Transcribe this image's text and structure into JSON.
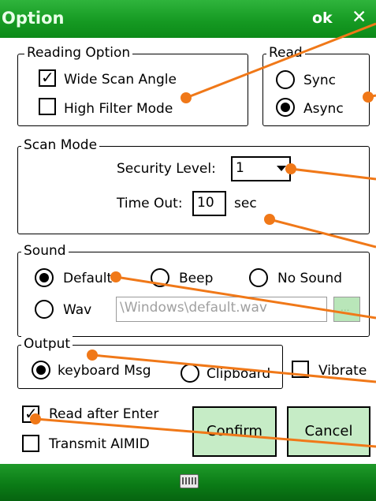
{
  "window": {
    "title": "Option",
    "ok_label": "ok",
    "close_glyph": "✕"
  },
  "reading_option": {
    "legend": "Reading Option",
    "wide_scan": {
      "label": "Wide Scan Angle",
      "checked": true
    },
    "high_filter": {
      "label": "High Filter Mode",
      "checked": false
    }
  },
  "read": {
    "legend": "Read",
    "options": [
      {
        "label": "Sync",
        "selected": false
      },
      {
        "label": "Async",
        "selected": true
      }
    ]
  },
  "scan_mode": {
    "legend": "Scan Mode",
    "security_label": "Security Level:",
    "security_value": "1",
    "timeout_label": "Time Out:",
    "timeout_value": "10",
    "timeout_unit": "sec"
  },
  "sound": {
    "legend": "Sound",
    "options": [
      {
        "label": "Default",
        "selected": true
      },
      {
        "label": "Beep",
        "selected": false
      },
      {
        "label": "No Sound",
        "selected": false
      },
      {
        "label": "Wav",
        "selected": false
      }
    ],
    "wav_path": "\\Windows\\default.wav",
    "browse_label": "..."
  },
  "output": {
    "legend": "Output",
    "options": [
      {
        "label": "keyboard Msg",
        "selected": true
      },
      {
        "label": "Clipboard",
        "selected": false
      }
    ]
  },
  "vibrate": {
    "label": "Vibrate",
    "checked": false
  },
  "read_after_enter": {
    "label": "Read after Enter",
    "checked": true
  },
  "transmit_aimid": {
    "label": "Transmit AIMID",
    "checked": false
  },
  "buttons": {
    "confirm": "Confirm",
    "cancel": "Cancel"
  },
  "colors": {
    "titlebar": "#169a23",
    "button_fill": "#c6ecc6",
    "callout": "#f07818"
  },
  "icons": {
    "close": "close-icon",
    "keyboard": "keyboard-icon"
  }
}
